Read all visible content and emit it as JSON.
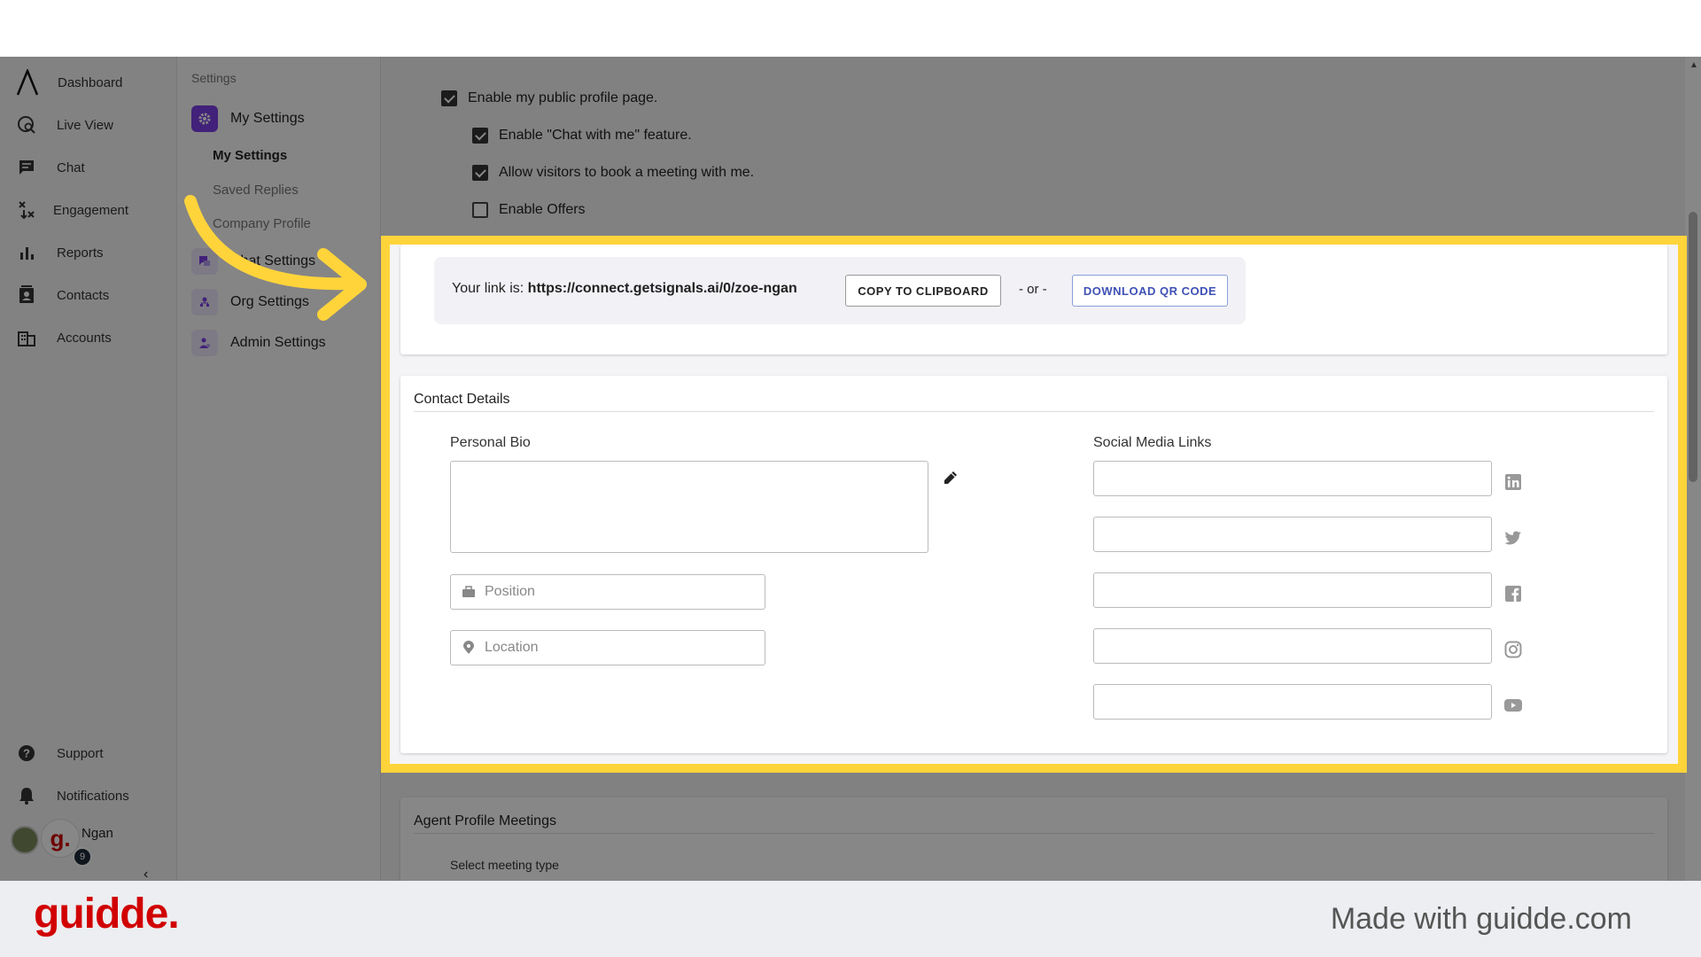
{
  "nav": {
    "items": [
      {
        "label": "Dashboard",
        "icon": "logo-icon"
      },
      {
        "label": "Live View",
        "icon": "live-view-icon"
      },
      {
        "label": "Chat",
        "icon": "chat-icon"
      },
      {
        "label": "Engagement",
        "icon": "engagement-icon"
      },
      {
        "label": "Reports",
        "icon": "bar-chart-icon"
      },
      {
        "label": "Contacts",
        "icon": "contacts-icon"
      },
      {
        "label": "Accounts",
        "icon": "building-icon"
      }
    ],
    "bottom": [
      {
        "label": "Support",
        "icon": "help-icon"
      },
      {
        "label": "Notifications",
        "icon": "bell-icon"
      }
    ],
    "user": {
      "name": "Ngan",
      "initial": "g.",
      "badge": "9"
    },
    "collapse": "‹"
  },
  "settings_sidebar": {
    "heading": "Settings",
    "my_settings": "My Settings",
    "sub_items": [
      "My Settings",
      "Saved Replies",
      "Company Profile"
    ],
    "chat_settings": "Chat Settings",
    "org_settings": "Org Settings",
    "admin_settings": "Admin Settings"
  },
  "profile_options": {
    "enable_public": {
      "label": "Enable my public profile page.",
      "checked": true
    },
    "chat_with_me": {
      "label": "Enable \"Chat with me\" feature.",
      "checked": true
    },
    "book_meeting": {
      "label": "Allow visitors to book a meeting with me.",
      "checked": true
    },
    "enable_offers": {
      "label": "Enable Offers",
      "checked": false
    }
  },
  "link": {
    "prefix": "Your link is: ",
    "url": "https://connect.getsignals.ai/0/zoe-ngan",
    "copy_button": "COPY TO CLIPBOARD",
    "or": "- or -",
    "qr_button": "DOWNLOAD QR CODE"
  },
  "contact_details": {
    "title": "Contact Details",
    "bio_label": "Personal Bio",
    "position_placeholder": "Position",
    "location_placeholder": "Location",
    "social_label": "Social Media Links",
    "social_icons": [
      "linkedin-icon",
      "twitter-icon",
      "facebook-icon",
      "instagram-icon",
      "youtube-icon"
    ]
  },
  "meetings": {
    "title": "Agent Profile Meetings",
    "select_label": "Select meeting type"
  },
  "footer": {
    "brand": "guidde.",
    "made_with": "Made with guidde.com"
  },
  "colors": {
    "highlight": "#ffd43b",
    "brand_red": "#d10000",
    "accent_blue": "#3f51b5",
    "settings_purple": "#7b3fe4"
  }
}
